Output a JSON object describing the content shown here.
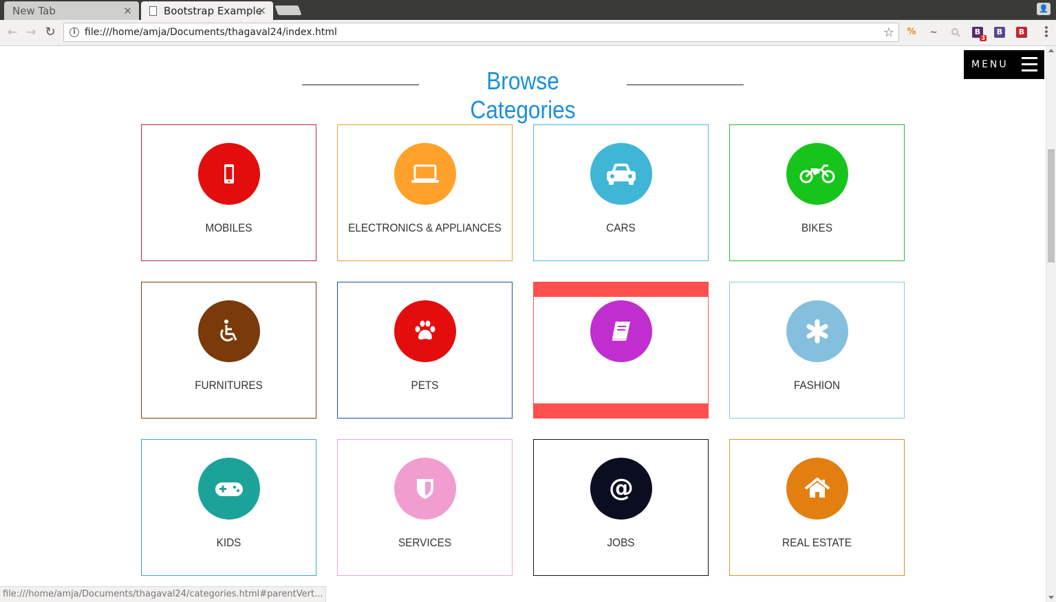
{
  "browser": {
    "tabs": [
      {
        "label": "New Tab",
        "active": false
      },
      {
        "label": "Bootstrap Example",
        "active": true
      }
    ],
    "url": "file:///home/amja/Documents/thagaval24/index.html",
    "status_url": "file:///home/amja/Documents/thagaval24/categories.html#parentVert...",
    "extensions": [
      {
        "name": "extension-sale-icon",
        "text": "%"
      },
      {
        "name": "extension-tilde-icon",
        "text": "~"
      },
      {
        "name": "extension-magnifier-icon",
        "text": ""
      },
      {
        "name": "extension-b-badge-icon",
        "text": "B",
        "badge": "3",
        "color": "#5b2b6e"
      },
      {
        "name": "extension-b-icon",
        "text": "B",
        "color": "#5b4a8b"
      },
      {
        "name": "extension-b-red-icon",
        "text": "B",
        "color": "#c0262c"
      }
    ]
  },
  "page": {
    "menu_label": "MENU",
    "heading": "Browse Categories",
    "heading_color": "#1a90d9",
    "hover_color": "#ff4f4f",
    "categories": [
      {
        "label": "MOBILES",
        "icon": "mobile-icon",
        "color": "#e30d0d",
        "border": "#b3263a"
      },
      {
        "label": "ELECTRONICS & APPLIANCES",
        "icon": "laptop-icon",
        "color": "#ffa12b",
        "border": "#e8a23a"
      },
      {
        "label": "CARS",
        "icon": "car-icon",
        "color": "#3fb6d6",
        "border": "#4db5e0"
      },
      {
        "label": "BIKES",
        "icon": "motorcycle-icon",
        "color": "#17c41c",
        "border": "#2cba34"
      },
      {
        "label": "FURNITURES",
        "icon": "wheelchair-icon",
        "color": "#7a3a0a",
        "border": "#7a3a0a"
      },
      {
        "label": "PETS",
        "icon": "paw-icon",
        "color": "#e30d0d",
        "border": "#1b4ca8"
      },
      {
        "label": "",
        "icon": "book-icon",
        "color": "#c02ed0",
        "border": "#ff4f4f",
        "hovered": true
      },
      {
        "label": "FASHION",
        "icon": "asterisk-icon",
        "color": "#84c0de",
        "border": "#8fc4e0"
      },
      {
        "label": "KIDS",
        "icon": "gamepad-icon",
        "color": "#1ba39a",
        "border": "#3aa6c8"
      },
      {
        "label": "SERVICES",
        "icon": "shield-icon",
        "color": "#f29dd0",
        "border": "#e8a6d8"
      },
      {
        "label": "JOBS",
        "icon": "at-icon",
        "color": "#0b0e21",
        "border": "#111111"
      },
      {
        "label": "REAL ESTATE",
        "icon": "home-icon",
        "color": "#e27f10",
        "border": "#d9912a"
      }
    ]
  }
}
